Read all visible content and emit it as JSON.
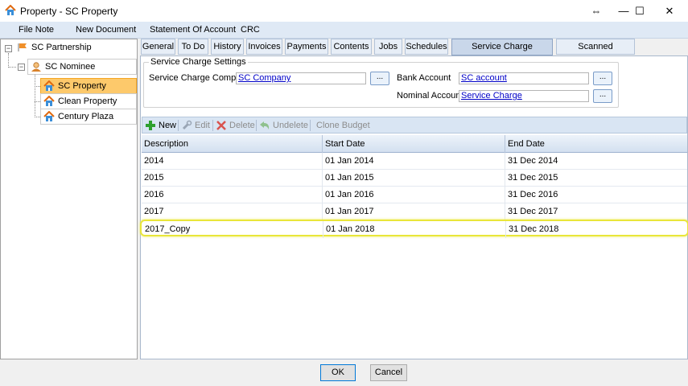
{
  "window": {
    "title": "Property - SC Property",
    "controls": {
      "restore": "⇔",
      "minimize": "—",
      "maximize": "☐",
      "close": "✕"
    }
  },
  "menu": [
    "File Note",
    "New Document",
    "Statement Of Account",
    "CRC"
  ],
  "tree": [
    {
      "label": "SC Partnership",
      "icon": "flag-icon"
    },
    {
      "label": "SC Nominee",
      "icon": "person-icon"
    },
    {
      "label": "SC Property",
      "icon": "house-icon",
      "selected": true
    },
    {
      "label": "Clean Property",
      "icon": "house-icon"
    },
    {
      "label": "Century Plaza",
      "icon": "house-icon"
    }
  ],
  "tabs": [
    "General",
    "To Do",
    "History",
    "Invoices",
    "Payments",
    "Contents",
    "Jobs",
    "Schedules",
    "Service Charge Expenditure",
    "Scanned Documents"
  ],
  "active_tab": "Service Charge Expenditure",
  "settings": {
    "legend": "Service Charge Settings",
    "company_label": "Service Charge Company",
    "company_value": "SC Company",
    "bank_label": "Bank Account",
    "bank_value": "SC account",
    "nominal_label": "Nominal Account",
    "nominal_value": "Service Charge",
    "browse_label": "..."
  },
  "toolbar": {
    "new": "New",
    "edit": "Edit",
    "delete": "Delete",
    "undelete": "Undelete",
    "clone": "Clone Budget"
  },
  "table": {
    "columns": [
      "Description",
      "Start Date",
      "End Date"
    ],
    "rows": [
      [
        "2014",
        "01 Jan 2014",
        "31 Dec 2014"
      ],
      [
        "2015",
        "01 Jan 2015",
        "31 Dec 2015"
      ],
      [
        "2016",
        "01 Jan 2016",
        "31 Dec 2016"
      ],
      [
        "2017",
        "01 Jan 2017",
        "31 Dec 2017"
      ],
      [
        "2017_Copy",
        "01 Jan 2018",
        "31 Dec 2018"
      ]
    ],
    "highlighted_row": 4
  },
  "footer": {
    "ok": "OK",
    "cancel": "Cancel"
  },
  "colors": {
    "selection_highlight": "#e9e63a",
    "tree_selected": "#fdc96b",
    "accent": "#0078d7"
  }
}
